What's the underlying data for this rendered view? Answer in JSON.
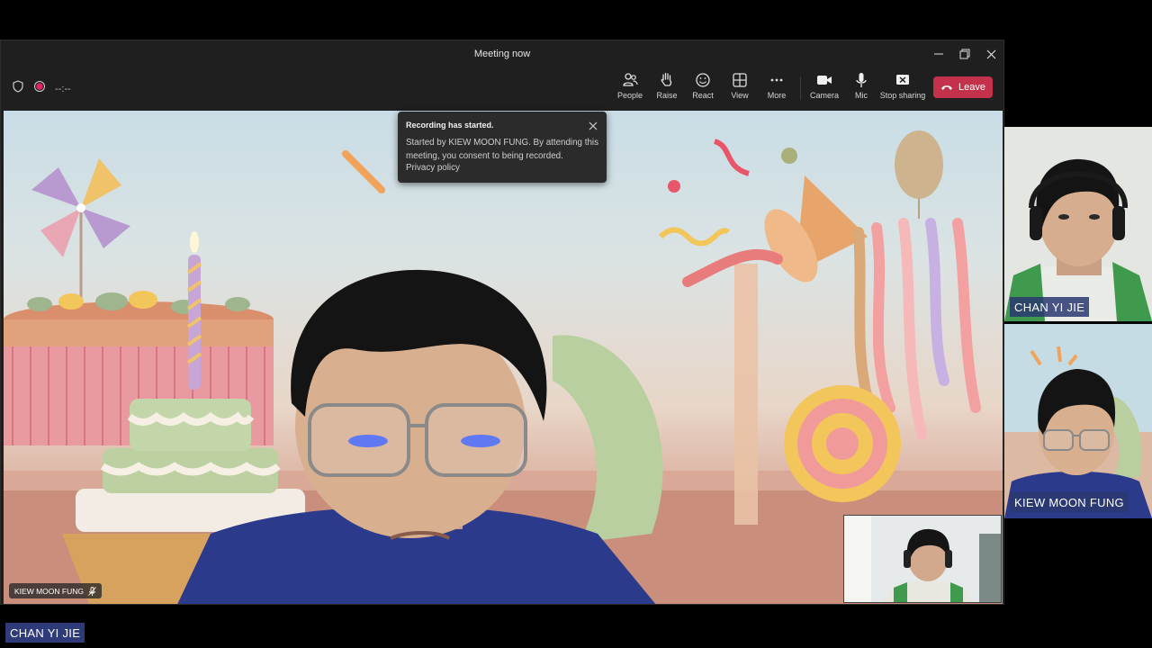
{
  "window": {
    "title": "Meeting now"
  },
  "toolbar": {
    "timer": "--:--",
    "buttons": {
      "people": "People",
      "raise": "Raise",
      "react": "React",
      "view": "View",
      "more": "More",
      "camera": "Camera",
      "mic": "Mic",
      "stop_sharing": "Stop sharing"
    },
    "leave": "Leave"
  },
  "toast": {
    "title": "Recording has started.",
    "body": "Started by KIEW MOON FUNG. By attending this meeting, you consent to being recorded.",
    "link": "Privacy policy"
  },
  "main_video": {
    "participant": "KIEW MOON FUNG"
  },
  "tiles": [
    {
      "name": "CHAN YI JIE"
    },
    {
      "name": "KIEW MOON FUNG"
    }
  ],
  "bottom_label": "CHAN YI JIE",
  "colors": {
    "leave": "#c4314b",
    "name_chip": "#2f3a78",
    "recording": "#e0245e"
  },
  "icons": [
    "shield-icon",
    "record-dot-icon",
    "people-icon",
    "raise-hand-icon",
    "react-icon",
    "view-icon",
    "more-icon",
    "camera-icon",
    "mic-icon",
    "stop-sharing-icon",
    "phone-hangup-icon",
    "minimize-icon",
    "restore-icon",
    "close-icon",
    "mic-off-icon"
  ]
}
